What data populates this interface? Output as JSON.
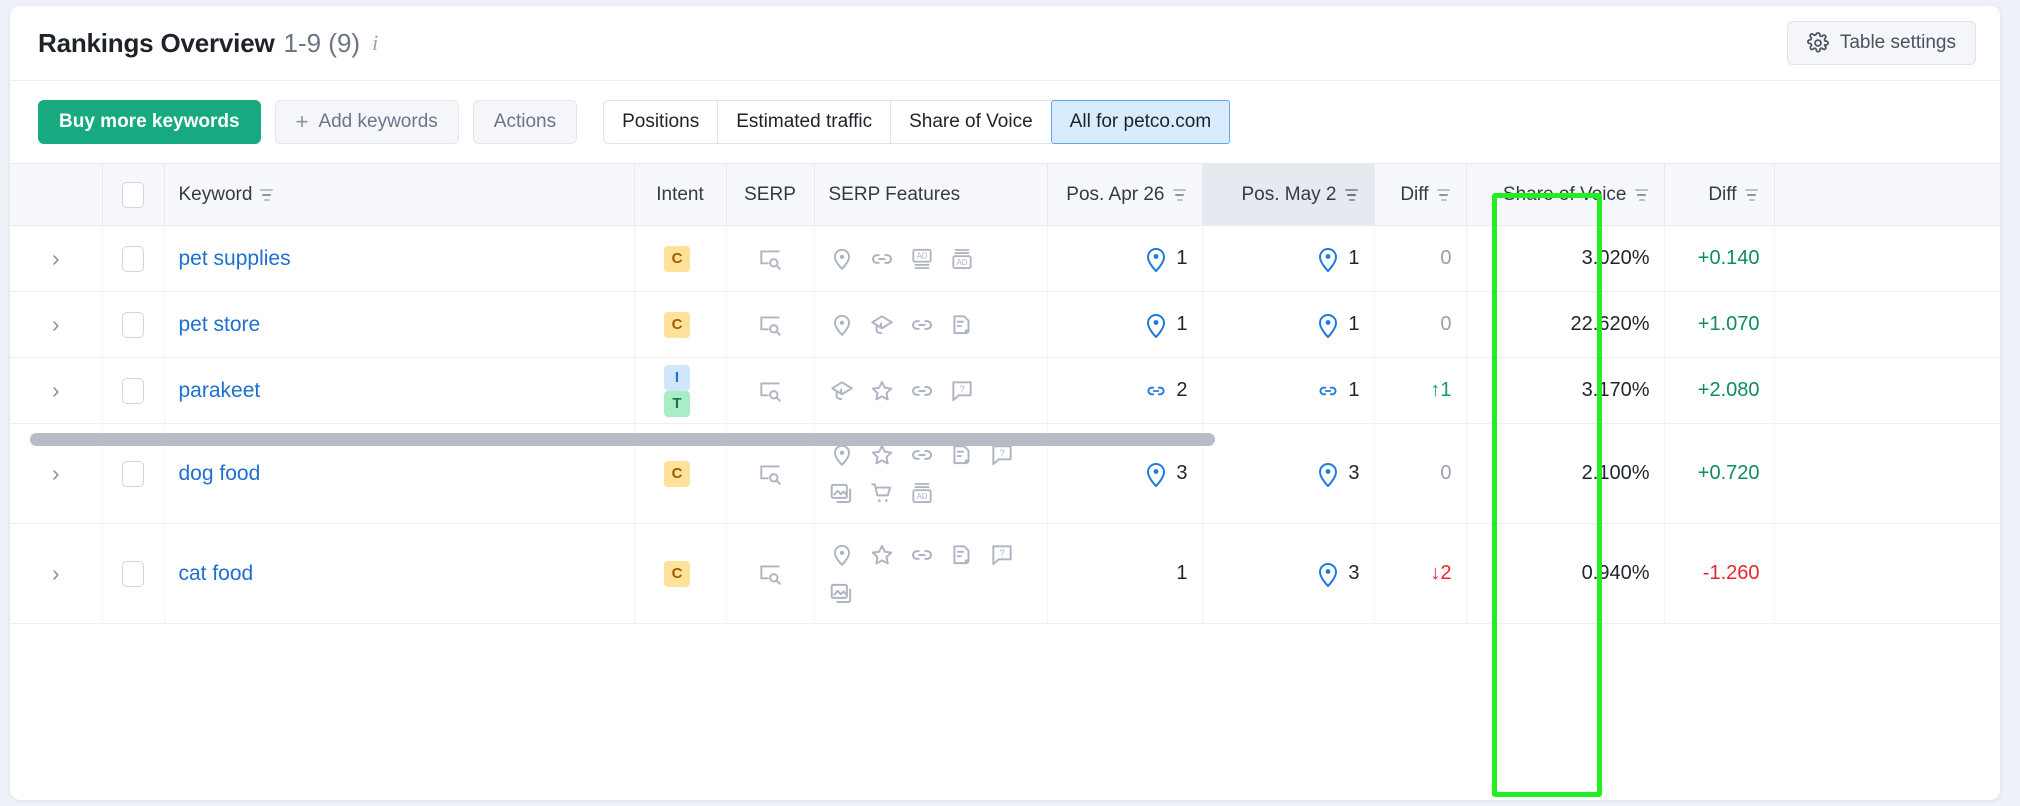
{
  "header": {
    "title": "Rankings Overview",
    "count": "1-9 (9)",
    "info_icon": "info-icon",
    "settings_label": "Table settings",
    "settings_icon": "gear-icon"
  },
  "toolbar": {
    "buy_label": "Buy more keywords",
    "add_label": "Add keywords",
    "add_icon": "plus-icon",
    "actions_label": "Actions",
    "segments": [
      {
        "label": "Positions",
        "active": false
      },
      {
        "label": "Estimated traffic",
        "active": false
      },
      {
        "label": "Share of Voice",
        "active": false
      },
      {
        "label": "All for petco.com",
        "active": true
      }
    ]
  },
  "table": {
    "columns": [
      {
        "key": "expand",
        "label": "",
        "sortable": false
      },
      {
        "key": "select",
        "label": "",
        "sortable": false
      },
      {
        "key": "keyword",
        "label": "Keyword",
        "sortable": true
      },
      {
        "key": "intent",
        "label": "Intent",
        "sortable": false
      },
      {
        "key": "serp",
        "label": "SERP",
        "sortable": false
      },
      {
        "key": "serp_features",
        "label": "SERP Features",
        "sortable": false
      },
      {
        "key": "pos_apr26",
        "label": "Pos. Apr 26",
        "sortable": true
      },
      {
        "key": "pos_may2",
        "label": "Pos. May 2",
        "sortable": true,
        "highlighted": true
      },
      {
        "key": "diff_pos",
        "label": "Diff",
        "sortable": true,
        "annotated": true
      },
      {
        "key": "share_of_voice",
        "label": "Share of Voice",
        "sortable": true
      },
      {
        "key": "diff_sov",
        "label": "Diff",
        "sortable": true
      }
    ],
    "rows": [
      {
        "keyword": "pet supplies",
        "intent": [
          "C"
        ],
        "serp_icon": "serp-preview-icon",
        "features": [
          "local-pack-icon",
          "sitelinks-icon",
          "ads-top-icon",
          "ads-bottom-icon"
        ],
        "pos_apr26": "1",
        "pos_apr26_icon": "local-pin-icon",
        "pos_may2": "1",
        "pos_may2_icon": "local-pin-icon",
        "diff_pos": "0",
        "diff_pos_dir": "zero",
        "share_of_voice": "3.020%",
        "diff_sov": "+0.140",
        "diff_sov_dir": "up"
      },
      {
        "keyword": "pet store",
        "intent": [
          "C"
        ],
        "serp_icon": "serp-preview-icon",
        "features": [
          "local-pack-icon",
          "knowledge-panel-icon",
          "sitelinks-icon",
          "featured-snippet-icon"
        ],
        "pos_apr26": "1",
        "pos_apr26_icon": "local-pin-icon",
        "pos_may2": "1",
        "pos_may2_icon": "local-pin-icon",
        "diff_pos": "0",
        "diff_pos_dir": "zero",
        "share_of_voice": "22.620%",
        "diff_sov": "+1.070",
        "diff_sov_dir": "up"
      },
      {
        "keyword": "parakeet",
        "intent": [
          "I",
          "T"
        ],
        "serp_icon": "serp-preview-icon",
        "features": [
          "knowledge-panel-icon",
          "reviews-icon",
          "sitelinks-icon",
          "faq-icon"
        ],
        "pos_apr26": "2",
        "pos_apr26_icon": "sitelinks-icon",
        "pos_may2": "1",
        "pos_may2_icon": "sitelinks-icon",
        "diff_pos": "1",
        "diff_pos_dir": "up",
        "share_of_voice": "3.170%",
        "diff_sov": "+2.080",
        "diff_sov_dir": "up"
      },
      {
        "keyword": "dog food",
        "intent": [
          "C"
        ],
        "serp_icon": "serp-preview-icon",
        "features": [
          "local-pack-icon",
          "reviews-icon",
          "sitelinks-icon",
          "featured-snippet-icon",
          "faq-icon",
          "image-pack-icon",
          "shopping-icon",
          "ads-bottom-icon"
        ],
        "pos_apr26": "3",
        "pos_apr26_icon": "local-pin-icon",
        "pos_may2": "3",
        "pos_may2_icon": "local-pin-icon",
        "diff_pos": "0",
        "diff_pos_dir": "zero",
        "share_of_voice": "2.100%",
        "diff_sov": "+0.720",
        "diff_sov_dir": "up"
      },
      {
        "keyword": "cat food",
        "intent": [
          "C"
        ],
        "serp_icon": "serp-preview-icon",
        "features": [
          "local-pack-icon",
          "reviews-icon",
          "sitelinks-icon",
          "featured-snippet-icon",
          "faq-icon",
          "image-pack-icon"
        ],
        "pos_apr26": "1",
        "pos_apr26_icon": "",
        "pos_may2": "3",
        "pos_may2_icon": "local-pin-icon",
        "diff_pos": "2",
        "diff_pos_dir": "down",
        "share_of_voice": "0.940%",
        "diff_sov": "-1.260",
        "diff_sov_dir": "down"
      }
    ]
  },
  "scrollbar": {
    "name": "horizontal-scrollbar"
  },
  "annotation": {
    "target_column": "Diff",
    "color": "#22ef22"
  },
  "colors": {
    "accent_green": "#17a97f",
    "link_blue": "#1f6fd0",
    "active_segment_bg": "#d9ecfe",
    "active_segment_border": "#61a9ef",
    "up_green": "#0f9d63",
    "down_red": "#e5262c",
    "annotation_green": "#22ef22"
  }
}
